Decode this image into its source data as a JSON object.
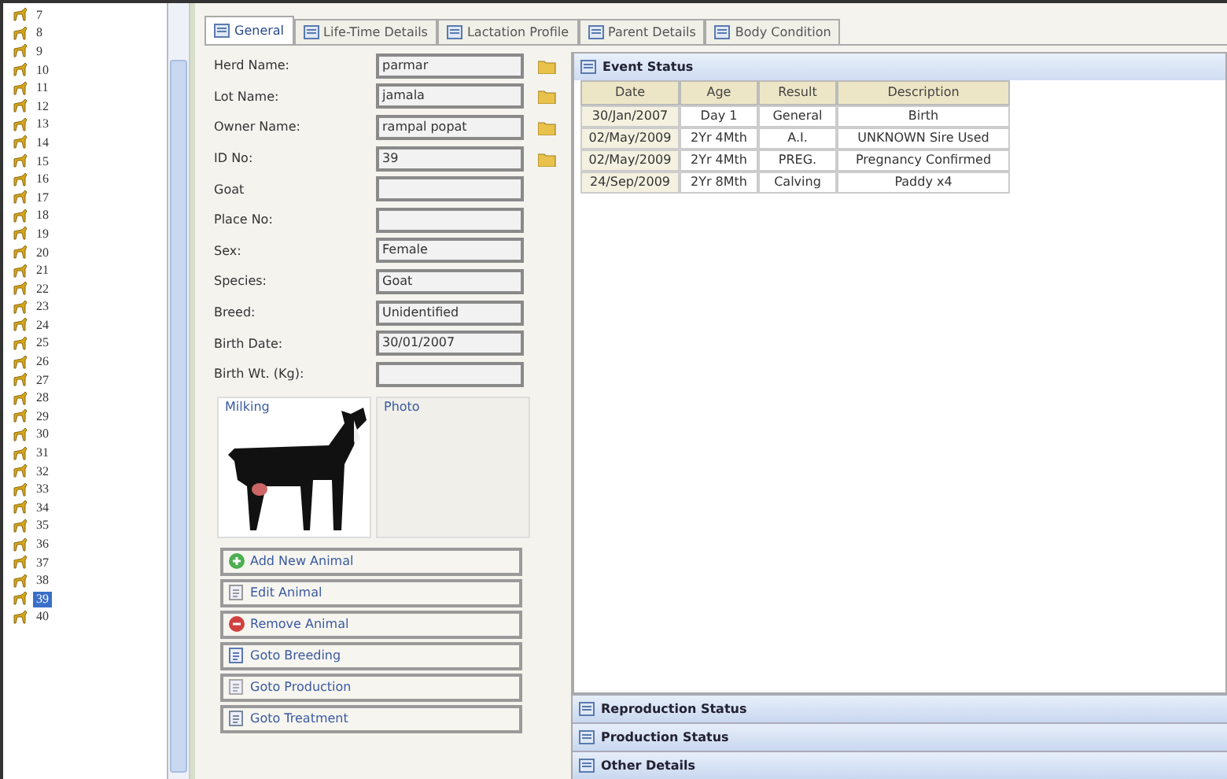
{
  "tree": {
    "items": [
      {
        "label": "7",
        "selected": false
      },
      {
        "label": "8",
        "selected": false
      },
      {
        "label": "9",
        "selected": false
      },
      {
        "label": "10",
        "selected": false
      },
      {
        "label": "11",
        "selected": false
      },
      {
        "label": "12",
        "selected": false
      },
      {
        "label": "13",
        "selected": false
      },
      {
        "label": "14",
        "selected": false
      },
      {
        "label": "15",
        "selected": false
      },
      {
        "label": "16",
        "selected": false
      },
      {
        "label": "17",
        "selected": false
      },
      {
        "label": "18",
        "selected": false
      },
      {
        "label": "19",
        "selected": false
      },
      {
        "label": "20",
        "selected": false
      },
      {
        "label": "21",
        "selected": false
      },
      {
        "label": "22",
        "selected": false
      },
      {
        "label": "23",
        "selected": false
      },
      {
        "label": "24",
        "selected": false
      },
      {
        "label": "25",
        "selected": false
      },
      {
        "label": "26",
        "selected": false
      },
      {
        "label": "27",
        "selected": false
      },
      {
        "label": "28",
        "selected": false
      },
      {
        "label": "29",
        "selected": false
      },
      {
        "label": "30",
        "selected": false
      },
      {
        "label": "31",
        "selected": false
      },
      {
        "label": "32",
        "selected": false
      },
      {
        "label": "33",
        "selected": false
      },
      {
        "label": "34",
        "selected": false
      },
      {
        "label": "35",
        "selected": false
      },
      {
        "label": "36",
        "selected": false
      },
      {
        "label": "37",
        "selected": false
      },
      {
        "label": "38",
        "selected": false
      },
      {
        "label": "39",
        "selected": true
      },
      {
        "label": "40",
        "selected": false
      }
    ]
  },
  "tabs": [
    {
      "label": "General",
      "selected": true
    },
    {
      "label": "Life-Time Details",
      "selected": false
    },
    {
      "label": "Lactation Profile",
      "selected": false
    },
    {
      "label": "Parent Details",
      "selected": false
    },
    {
      "label": "Body Condition",
      "selected": false
    }
  ],
  "form": [
    {
      "label": "Herd Name:",
      "value": "parmar",
      "browse": true
    },
    {
      "label": "Lot Name:",
      "value": "jamala",
      "browse": true
    },
    {
      "label": "Owner Name:",
      "value": "rampal popat",
      "browse": true
    },
    {
      "label": "ID No:",
      "value": "39",
      "browse": true
    },
    {
      "label": "Goat",
      "browse": false
    },
    {
      "label": "Place No:",
      "browse": false
    },
    {
      "label": "Sex:",
      "value": "Female",
      "browse": false
    },
    {
      "label": "Species:",
      "value": "Goat",
      "browse": false
    },
    {
      "label": "Breed:",
      "value": "Unidentified",
      "browse": false
    },
    {
      "label": "Birth Date:",
      "value": "30/01/2007",
      "browse": false
    },
    {
      "label": "Birth Wt. (Kg):",
      "browse": false
    }
  ],
  "photos": [
    {
      "title": "Milking",
      "kind": "picture"
    },
    {
      "title": "Photo",
      "kind": "empty"
    }
  ],
  "actions": [
    {
      "label": "Add New Animal",
      "kind": "add"
    },
    {
      "label": "Edit Animal",
      "kind": "edit"
    },
    {
      "label": "Remove Animal",
      "kind": "remove"
    },
    {
      "label": "Goto Breeding",
      "kind": "breeding"
    },
    {
      "label": "Goto Production",
      "kind": "production"
    },
    {
      "label": "Goto Treatment",
      "kind": "treatment"
    }
  ],
  "event_status": {
    "title": "Event Status",
    "columns": [
      "Date",
      "Age",
      "Result",
      "Description"
    ],
    "rows": [
      [
        "30/Jan/2007",
        "Day 1",
        "General",
        "Birth"
      ],
      [
        "02/May/2009",
        "2Yr 4Mth",
        "A.I.",
        "UNKNOWN Sire Used"
      ],
      [
        "02/May/2009",
        "2Yr 4Mth",
        "PREG.",
        "Pregnancy Confirmed"
      ],
      [
        "24/Sep/2009",
        "2Yr 8Mth",
        "Calving",
        "Paddy x4"
      ]
    ]
  },
  "sections": [
    "Reproduction Status",
    "Production Status",
    "Other Details"
  ]
}
